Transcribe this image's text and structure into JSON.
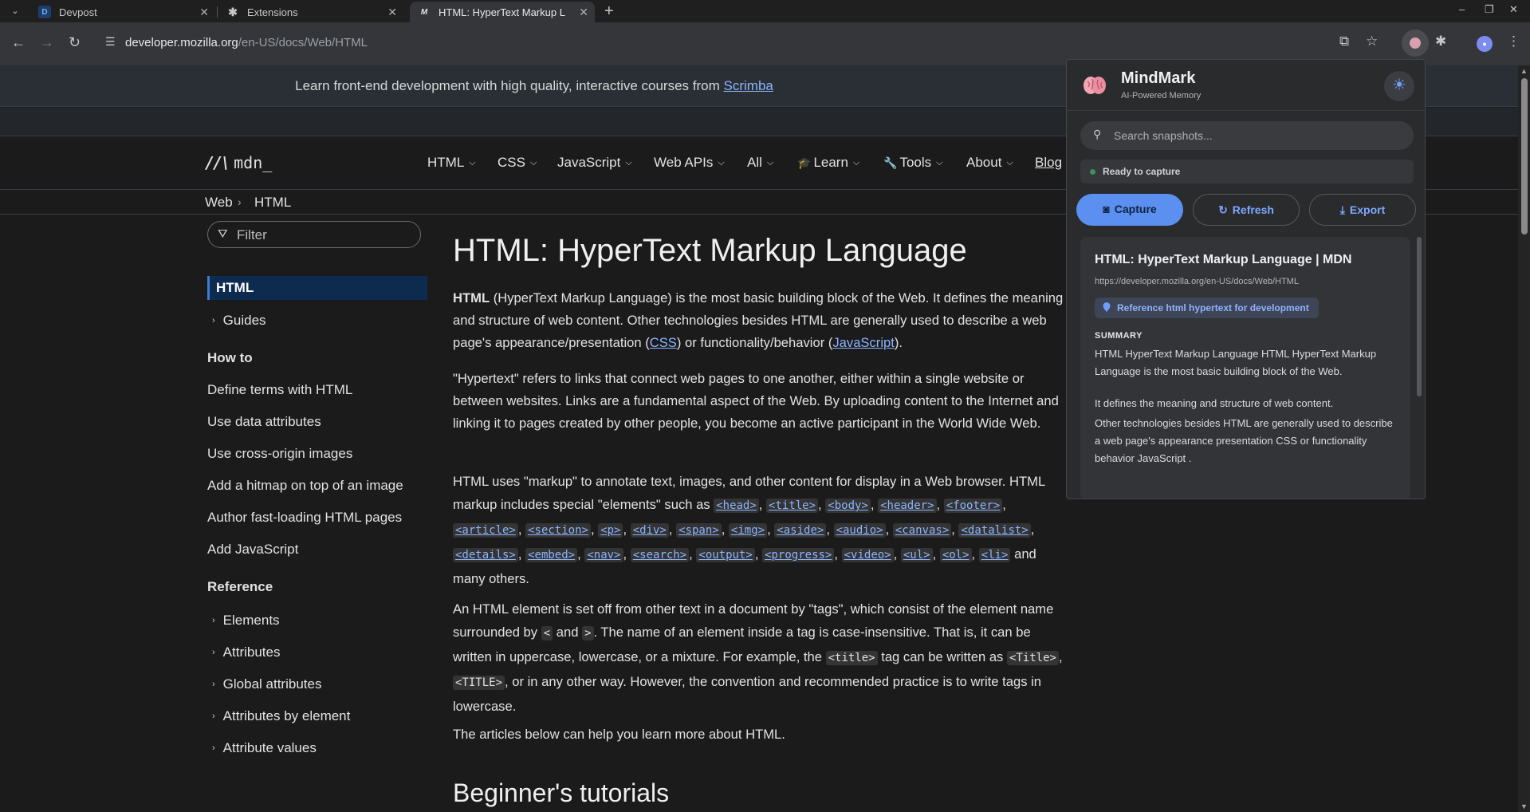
{
  "browser": {
    "tabs": [
      {
        "title": "Devpost",
        "favicon": "D"
      },
      {
        "title": "Extensions",
        "favicon": "puzzle"
      },
      {
        "title": "HTML: HyperText Markup L",
        "favicon": "M"
      }
    ],
    "url_host": "developer.mozilla.org",
    "url_path": "/en-US/docs/Web/HTML"
  },
  "banner": {
    "text": "Learn front-end development with high quality, interactive courses from ",
    "link": "Scrimba"
  },
  "mdn_nav": {
    "logo": "mdn_",
    "items": [
      "HTML",
      "CSS",
      "JavaScript",
      "Web APIs",
      "All",
      "Learn",
      "Tools",
      "About",
      "Blog"
    ]
  },
  "breadcrumbs": [
    "Web",
    "HTML"
  ],
  "sidebar": {
    "filter_placeholder": "Filter",
    "active": "HTML",
    "guides": "Guides",
    "howto_heading": "How to",
    "howto_items": [
      "Define terms with HTML",
      "Use data attributes",
      "Use cross-origin images",
      "Add a hitmap on top of an image",
      "Author fast-loading HTML pages",
      "Add JavaScript"
    ],
    "reference_heading": "Reference",
    "reference_items": [
      "Elements",
      "Attributes",
      "Global attributes",
      "Attributes by element",
      "Attribute values"
    ]
  },
  "article": {
    "title": "HTML: HyperText Markup Language",
    "p1": {
      "bold": "HTML",
      "a": " (HyperText Markup Language) is the most basic building block of the Web. It defines the meaning and structure of web content. Other technologies besides HTML are generally used to describe a web page's appearance/presentation (",
      "css": "CSS",
      "b": ") or functionality/behavior (",
      "js": "JavaScript",
      "c": ")."
    },
    "p2": "\"Hypertext\" refers to links that connect web pages to one another, either within a single website or between websites. Links are a fundamental aspect of the Web. By uploading content to the Internet and linking it to pages created by other people, you become an active participant in the World Wide Web.",
    "p3_intro": "HTML uses \"markup\" to annotate text, images, and other content for display in a Web browser. HTML markup includes special \"elements\" such as ",
    "p3_tags": [
      "<head>",
      "<title>",
      "<body>",
      "<header>",
      "<footer>",
      "<article>",
      "<section>",
      "<p>",
      "<div>",
      "<span>",
      "<img>",
      "<aside>",
      "<audio>",
      "<canvas>",
      "<datalist>",
      "<details>",
      "<embed>",
      "<nav>",
      "<search>",
      "<output>",
      "<progress>",
      "<video>",
      "<ul>",
      "<ol>",
      "<li>"
    ],
    "p3_end": " and many others.",
    "p4": {
      "a": "An HTML element is set off from other text in a document by \"tags\", which consist of the element name surrounded by ",
      "lt": "<",
      "and": " and ",
      "gt": ">",
      "b": ". The name of an element inside a tag is case-insensitive. That is, it can be written in uppercase, lowercase, or a mixture. For example, the ",
      "title": "<title>",
      "c": " tag can be written as ",
      "title2": "<Title>",
      "comma": ", ",
      "title3": "<TITLE>",
      "d": ", or in any other way. However, the convention and recommended practice is to write tags in lowercase."
    },
    "p5": "The articles below can help you learn more about HTML.",
    "h2": "Beginner's tutorials"
  },
  "extension": {
    "name": "MindMark",
    "tagline": "AI-Powered Memory",
    "search_placeholder": "Search snapshots...",
    "status": "Ready to capture",
    "buttons": {
      "capture": "Capture",
      "refresh": "Refresh",
      "export": "Export"
    },
    "card": {
      "title": "HTML: HyperText Markup Language | MDN",
      "url": "https://developer.mozilla.org/en-US/docs/Web/HTML",
      "tag": "Reference html hypertext for development",
      "summary_heading": "SUMMARY",
      "summary": [
        "HTML HyperText Markup Language HTML HyperText Markup Language is the most basic building block of the Web.",
        "It defines the meaning and structure of web content.",
        "Other technologies besides HTML are generally used to describe a web page's appearance presentation CSS or functionality behavior JavaScript ."
      ]
    },
    "accent": "#5b8ff0"
  }
}
